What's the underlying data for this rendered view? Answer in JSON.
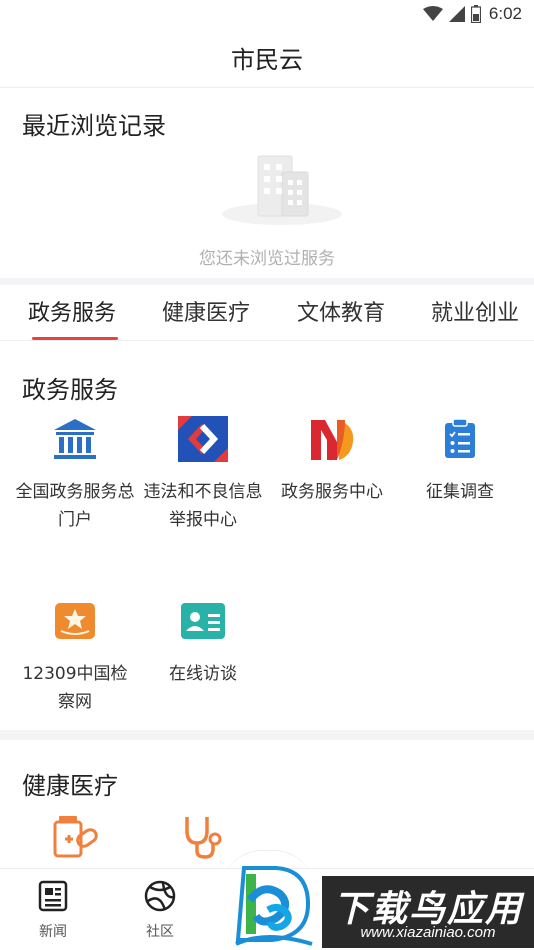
{
  "status_bar": {
    "time": "6:02"
  },
  "header": {
    "title": "市民云"
  },
  "recent": {
    "heading": "最近浏览记录",
    "empty_text": "您还未浏览过服务"
  },
  "tabs": [
    {
      "label": "政务服务",
      "active": true
    },
    {
      "label": "健康医疗",
      "active": false
    },
    {
      "label": "文体教育",
      "active": false
    },
    {
      "label": "就业创业",
      "active": false
    }
  ],
  "sections": {
    "gov": {
      "heading": "政务服务",
      "items": [
        {
          "label": "全国政务服务总门户",
          "icon": "government-building-icon"
        },
        {
          "label": "违法和不良信息举报中心",
          "icon": "report-center-icon"
        },
        {
          "label": "政务服务中心",
          "icon": "gov-service-center-icon"
        },
        {
          "label": "征集调查",
          "icon": "survey-clipboard-icon"
        },
        {
          "label": "12309中国检察网",
          "icon": "procuratorate-badge-icon"
        },
        {
          "label": "在线访谈",
          "icon": "online-interview-icon"
        }
      ]
    },
    "health": {
      "heading": "健康医疗",
      "items": [
        {
          "icon": "medicine-icon"
        },
        {
          "icon": "stethoscope-icon"
        }
      ]
    }
  },
  "bottom_nav": [
    {
      "label": "新闻",
      "icon": "news-icon"
    },
    {
      "label": "社区",
      "icon": "community-icon"
    }
  ],
  "watermark": {
    "title": "下载鸟应用",
    "url": "www.xiazainiao.com"
  },
  "colors": {
    "accent": "#e8423e",
    "gov_blue": "#2b6fc7",
    "orange": "#f08a2e",
    "teal": "#29b3a8"
  }
}
